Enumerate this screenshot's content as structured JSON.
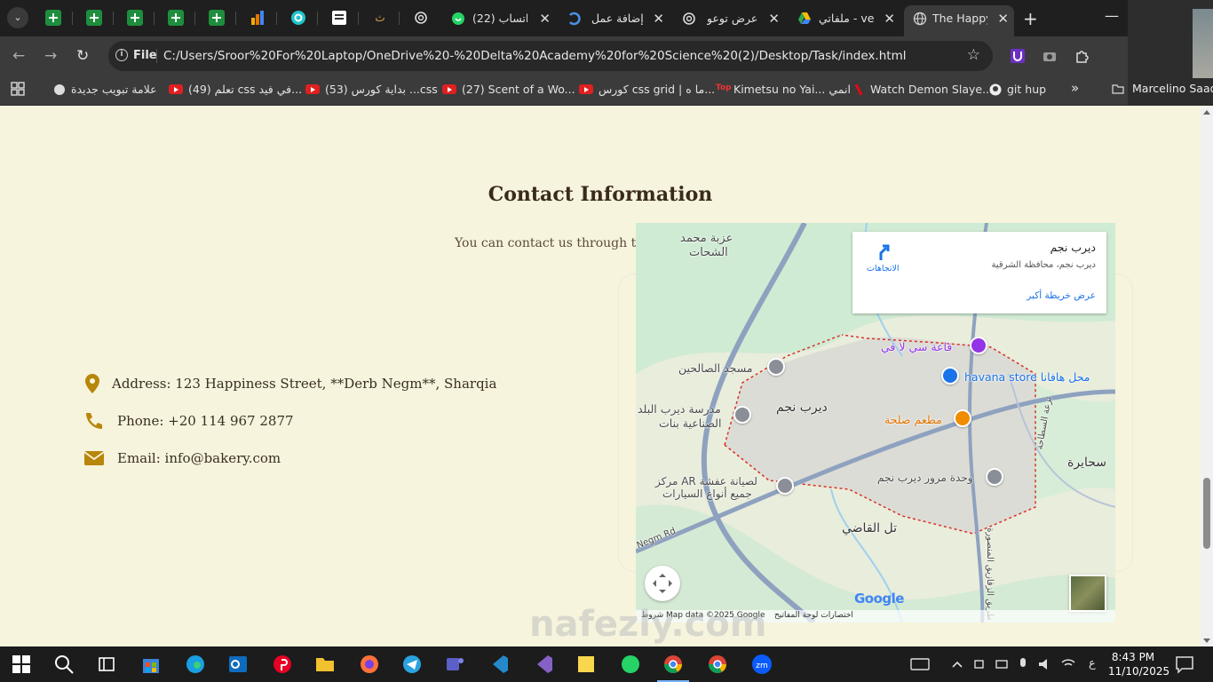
{
  "browser": {
    "tabs": [
      {
        "title": "واتساب (22)",
        "close": "✕"
      },
      {
        "title": "إضافة عمل",
        "close": "✕"
      },
      {
        "title": "عرض توعو",
        "close": "✕"
      },
      {
        "title": "ملفاتي - ve",
        "close": "✕"
      },
      {
        "title": "The Happy",
        "close": "✕"
      }
    ],
    "pinned_glyph": "ث",
    "new_tab": "+",
    "minimize": "—",
    "thumbnail_name": "Marcelino Saad",
    "tab_list": "⌄",
    "nav": {
      "back": "←",
      "forward": "→",
      "reload": "↻"
    },
    "address": {
      "info": "i",
      "scheme": "File",
      "url": "C:/Users/Sroor%20For%20Laptop/OneDrive%20-%20Delta%20Academy%20for%20Science%20(2)/Desktop/Task/index.html",
      "star": "☆"
    },
    "bookmarks": [
      "علامة تبويب جديدة",
      "(49) تعلم css في فيد...",
      "(53) بداية كورس ...css",
      "(27) Scent of a Wo...",
      "كورس css grid | ما ه...",
      "Kimetsu no Yai... انمي",
      "Watch Demon Slaye...",
      "git hup"
    ],
    "bookmarks_more": "»",
    "other_bookmarks": "Marcelino Saad"
  },
  "page": {
    "section_title": "Contact Information",
    "lead": "You can contact us through the",
    "contacts": [
      {
        "icon": "location-pin-icon",
        "text": "Address: 123 Happiness Street, **Derb Negm**, Sharqia"
      },
      {
        "icon": "phone-icon",
        "text": "Phone: +20 114 967 2877"
      },
      {
        "icon": "envelope-icon",
        "text": "Email: info@bakery.com"
      }
    ],
    "watermark": "nafezly.com"
  },
  "map": {
    "info_title": "ديرب نجم",
    "info_subtitle": "ديرب نجم، محافظة الشرقية",
    "info_link": "عرض خريطة أكبر",
    "directions_label": "الاتجاهات",
    "labels": {
      "top_left": "عزبة محمد",
      "top_left_2": "الشحات",
      "mosque": "مسجد الصالحين",
      "school": "مدرسة ديرب البلد",
      "school_2": "الصناعية بنات",
      "town": "ديرب نجم",
      "restaurant": "مطعم صلحة",
      "store": "havana store محل هافانا",
      "hall": "قاعة سي لا في",
      "traffic": "وحدة مرور ديرب نجم",
      "car_center": "مركز AR لصيانة عفشة",
      "car_center_2": "جميع أنواع السيارات",
      "village": "تل القاضي",
      "right_edge": "سحايرة",
      "road": "Negm Rd",
      "road_vertical": "طريق الزقازيق المنصورة",
      "road_right": "ترعة السطاحة"
    },
    "google": "Google",
    "footer_left": "شروط",
    "footer_data": "Map data ©2025 Google",
    "footer_shortcuts": "اختصارات لوحة المفاتيح"
  },
  "taskbar": {
    "time": "8:43 PM",
    "date": "11/10/2025",
    "lang": "ع"
  }
}
